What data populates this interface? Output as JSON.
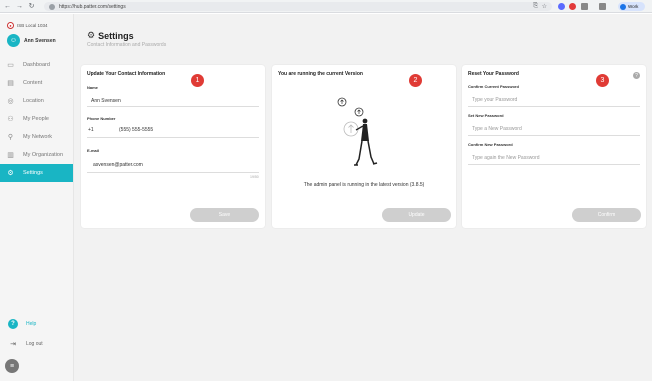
{
  "browser": {
    "url": "https://hub.patter.com/settings",
    "profile_label": "Work"
  },
  "sidebar": {
    "org_name": "ISB Local 1034",
    "user_name": "Ann Svensen",
    "items": [
      {
        "label": "Dashboard",
        "icon": "dashboard-icon"
      },
      {
        "label": "Content",
        "icon": "content-icon"
      },
      {
        "label": "Location",
        "icon": "location-pin-icon"
      },
      {
        "label": "My People",
        "icon": "people-icon"
      },
      {
        "label": "My Network",
        "icon": "network-icon"
      },
      {
        "label": "My Organization",
        "icon": "organization-icon"
      },
      {
        "label": "Settings",
        "icon": "gear-icon",
        "active": true
      }
    ],
    "help_label": "Help",
    "logout_label": "Log out"
  },
  "page": {
    "title": "Settings",
    "subtitle": "Contact Information and Passwords"
  },
  "contact_card": {
    "title": "Update Your Contact Information",
    "badge": "1",
    "name_label": "Name",
    "name_value": "Ann Svensen",
    "phone_label": "Phone Number",
    "country_code": "+1",
    "phone_value": "(555) 555-5555",
    "email_label": "E-mail",
    "email_value": "asvensen@patter.com",
    "email_counter": "19/50",
    "save_label": "Save"
  },
  "version_card": {
    "title": "You are running the current Version",
    "badge": "2",
    "message": "The admin panel is running in the latest version (3.8.5)",
    "update_label": "Update"
  },
  "password_card": {
    "title": "Reset Your Password",
    "badge": "3",
    "current_label": "Confirm Current Password",
    "current_placeholder": "Type your Password",
    "new_label": "Set New Password",
    "new_placeholder": "Type a New Password",
    "confirm_label": "Confirm New Password",
    "confirm_placeholder": "Type again the New Password",
    "confirm_button": "Confirm"
  },
  "colors": {
    "accent": "#19b5c4",
    "badge": "#e03b35",
    "button_disabled": "#cfcfcf"
  }
}
